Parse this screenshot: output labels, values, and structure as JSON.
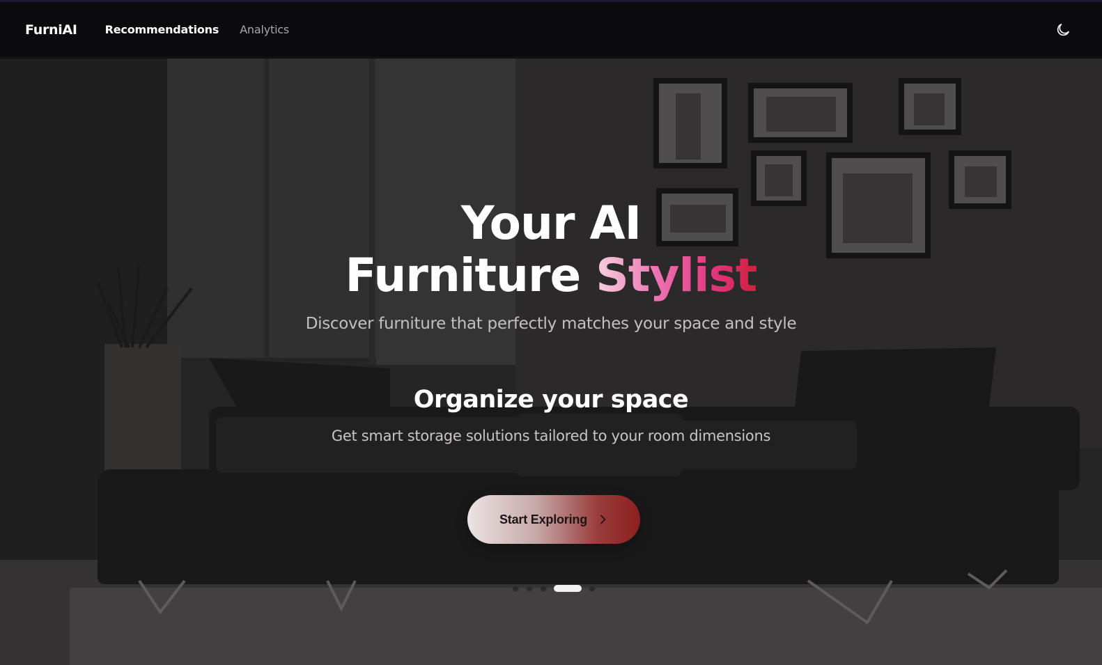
{
  "header": {
    "brand": "FurniAI",
    "nav": [
      {
        "label": "Recommendations",
        "active": true
      },
      {
        "label": "Analytics",
        "active": false
      }
    ],
    "theme_toggle_icon": "moon-icon"
  },
  "hero": {
    "headline_line1": "Your AI",
    "headline_line2_plain": "Furniture ",
    "headline_line2_accent": "Stylist",
    "subtitle": "Discover furniture that perfectly matches your space and style",
    "slide": {
      "title": "Organize your space",
      "description": "Get smart storage solutions tailored to your room dimensions"
    },
    "cta": {
      "label": "Start Exploring",
      "icon": "chevron-right-icon"
    },
    "carousel": {
      "total": 5,
      "active_index": 3
    }
  },
  "colors": {
    "nav_background": "#0b0a0d",
    "accent_gradient_start": "#f6d0e0",
    "accent_gradient_end": "#d11f3c",
    "button_gradient_end": "#8c1f1f"
  }
}
